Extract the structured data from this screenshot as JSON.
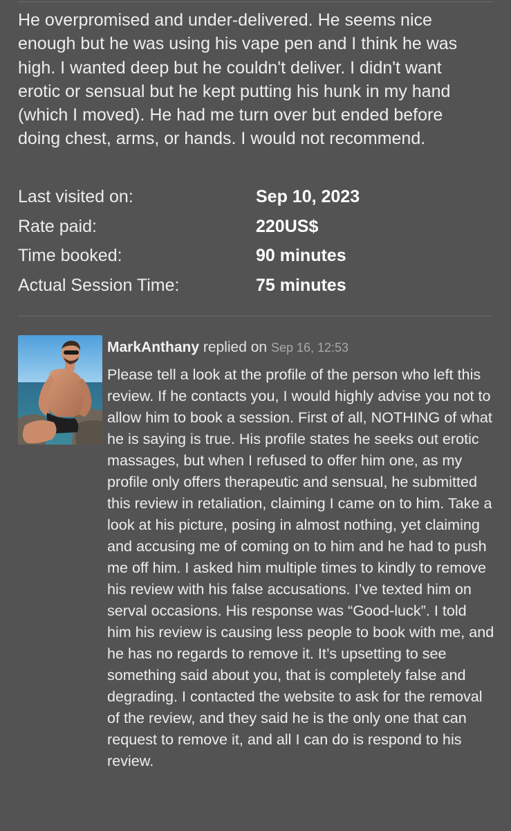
{
  "review": {
    "text": "He overpromised and under-delivered. He seems nice enough but he was using his vape pen and I think he was high. I wanted deep but he couldn't deliver. I didn't want erotic or sensual but he kept putting his hunk in my hand (which I moved). He had me turn over but ended before doing chest, arms, or hands. I would not recommend."
  },
  "details": [
    {
      "label": "Last visited on:",
      "value": "Sep 10, 2023"
    },
    {
      "label": "Rate paid:",
      "value": "220US$"
    },
    {
      "label": "Time booked:",
      "value": "90 minutes"
    },
    {
      "label": "Actual Session Time:",
      "value": "75 minutes"
    }
  ],
  "reply": {
    "author": "MarkAnthany",
    "verb": "replied on",
    "date": "Sep 16, 12:53",
    "text": "Please tell a look at the profile of the person who left this review. If he contacts you, I would highly advise you not to allow him to book a session. First of all, NOTHING of what he is saying is true. His profile states he seeks out erotic massages, but when I refused to offer him one, as my profile only offers therapeutic and sensual, he submitted this review in retaliation, claiming I came on to him. Take a look at his picture, posing in almost nothing, yet claiming and accusing me of coming on to him and he had to push me off him. I asked him multiple times to kindly to remove his review with his false accusations. I’ve texted him on serval occasions. His response was “Good-luck”. I told him his review is causing less people to book with me, and he has no regards to remove it. It’s upsetting to see something said about you, that is completely false and degrading. I contacted the website to ask for the removal of the review, and they said he is the only one that can request to remove it, and all I can do is respond to his review."
  }
}
